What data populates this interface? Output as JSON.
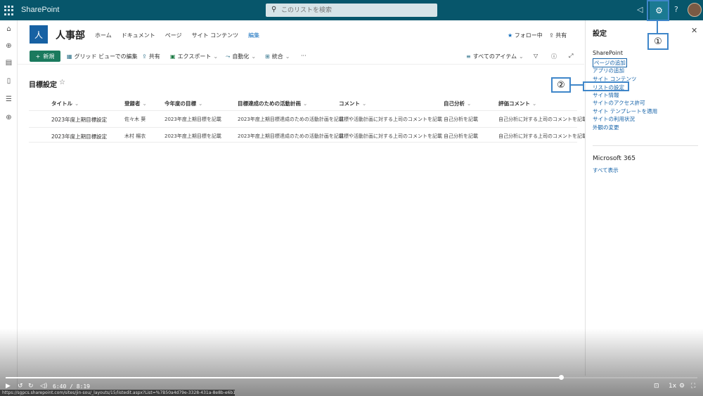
{
  "suite": {
    "brand": "SharePoint",
    "search_placeholder": "このリストを検索"
  },
  "site": {
    "logo_letter": "人",
    "title": "人事部",
    "nav": [
      "ホーム",
      "ドキュメント",
      "ページ",
      "サイト コンテンツ",
      "編集"
    ],
    "follow": "フォロー中",
    "share": "共有"
  },
  "commandbar": {
    "new": "新規",
    "grid_edit": "グリッド ビューでの編集",
    "share": "共有",
    "export": "エクスポート",
    "automate": "自動化",
    "integrate": "統合",
    "more": "···",
    "view": "すべてのアイテム"
  },
  "list": {
    "title": "目標設定",
    "columns": [
      "タイトル",
      "登録者",
      "今年度の目標",
      "目標達成のための活動計画",
      "コメント",
      "自己分析",
      "評価コメント"
    ],
    "rows": [
      [
        "2023年度上期目標設定",
        "佐々木 葵",
        "2023年度上期目標を記載",
        "2023年度上期目標達成のための活動計画を記載",
        "目標や活動計画に対する上司のコメントを記載",
        "自己分析を記載",
        "自己分析に対する上司のコメントを記載"
      ],
      [
        "2023年度上期目標設定",
        "木村 楊衣",
        "2023年度上期目標を記載",
        "2023年度上期目標達成のための活動計画を記載",
        "目標や活動計画に対する上司のコメントを記載",
        "自己分析を記載",
        "自己分析に対する上司のコメントを記載"
      ]
    ]
  },
  "settings_panel": {
    "title": "設定",
    "section_sharepoint": "SharePoint",
    "links": [
      "ページの追加",
      "アプリの追加",
      "サイト コンテンツ",
      "リストの設定",
      "サイト情報",
      "サイトのアクセス許可",
      "サイト テンプレートを適用",
      "サイトの利用状況",
      "外観の変更"
    ],
    "section_m365": "Microsoft 365",
    "show_all": "すべて表示"
  },
  "callouts": {
    "one": "①",
    "two": "②"
  },
  "player": {
    "time": "6:40 / 8:19",
    "speed": "1x",
    "progress": 0.8,
    "url": "https://sgpcs.sharepoint.com/sites/jin-sou/_layouts/15/listedit.aspx?List=%7B50a4d79e-3328-431a-8e8b-e6b1b37e1..."
  },
  "colors": {
    "suitebar": "#07566b",
    "accent": "#1b7a5e",
    "link": "#1462a8",
    "callout": "#3f86c9"
  }
}
